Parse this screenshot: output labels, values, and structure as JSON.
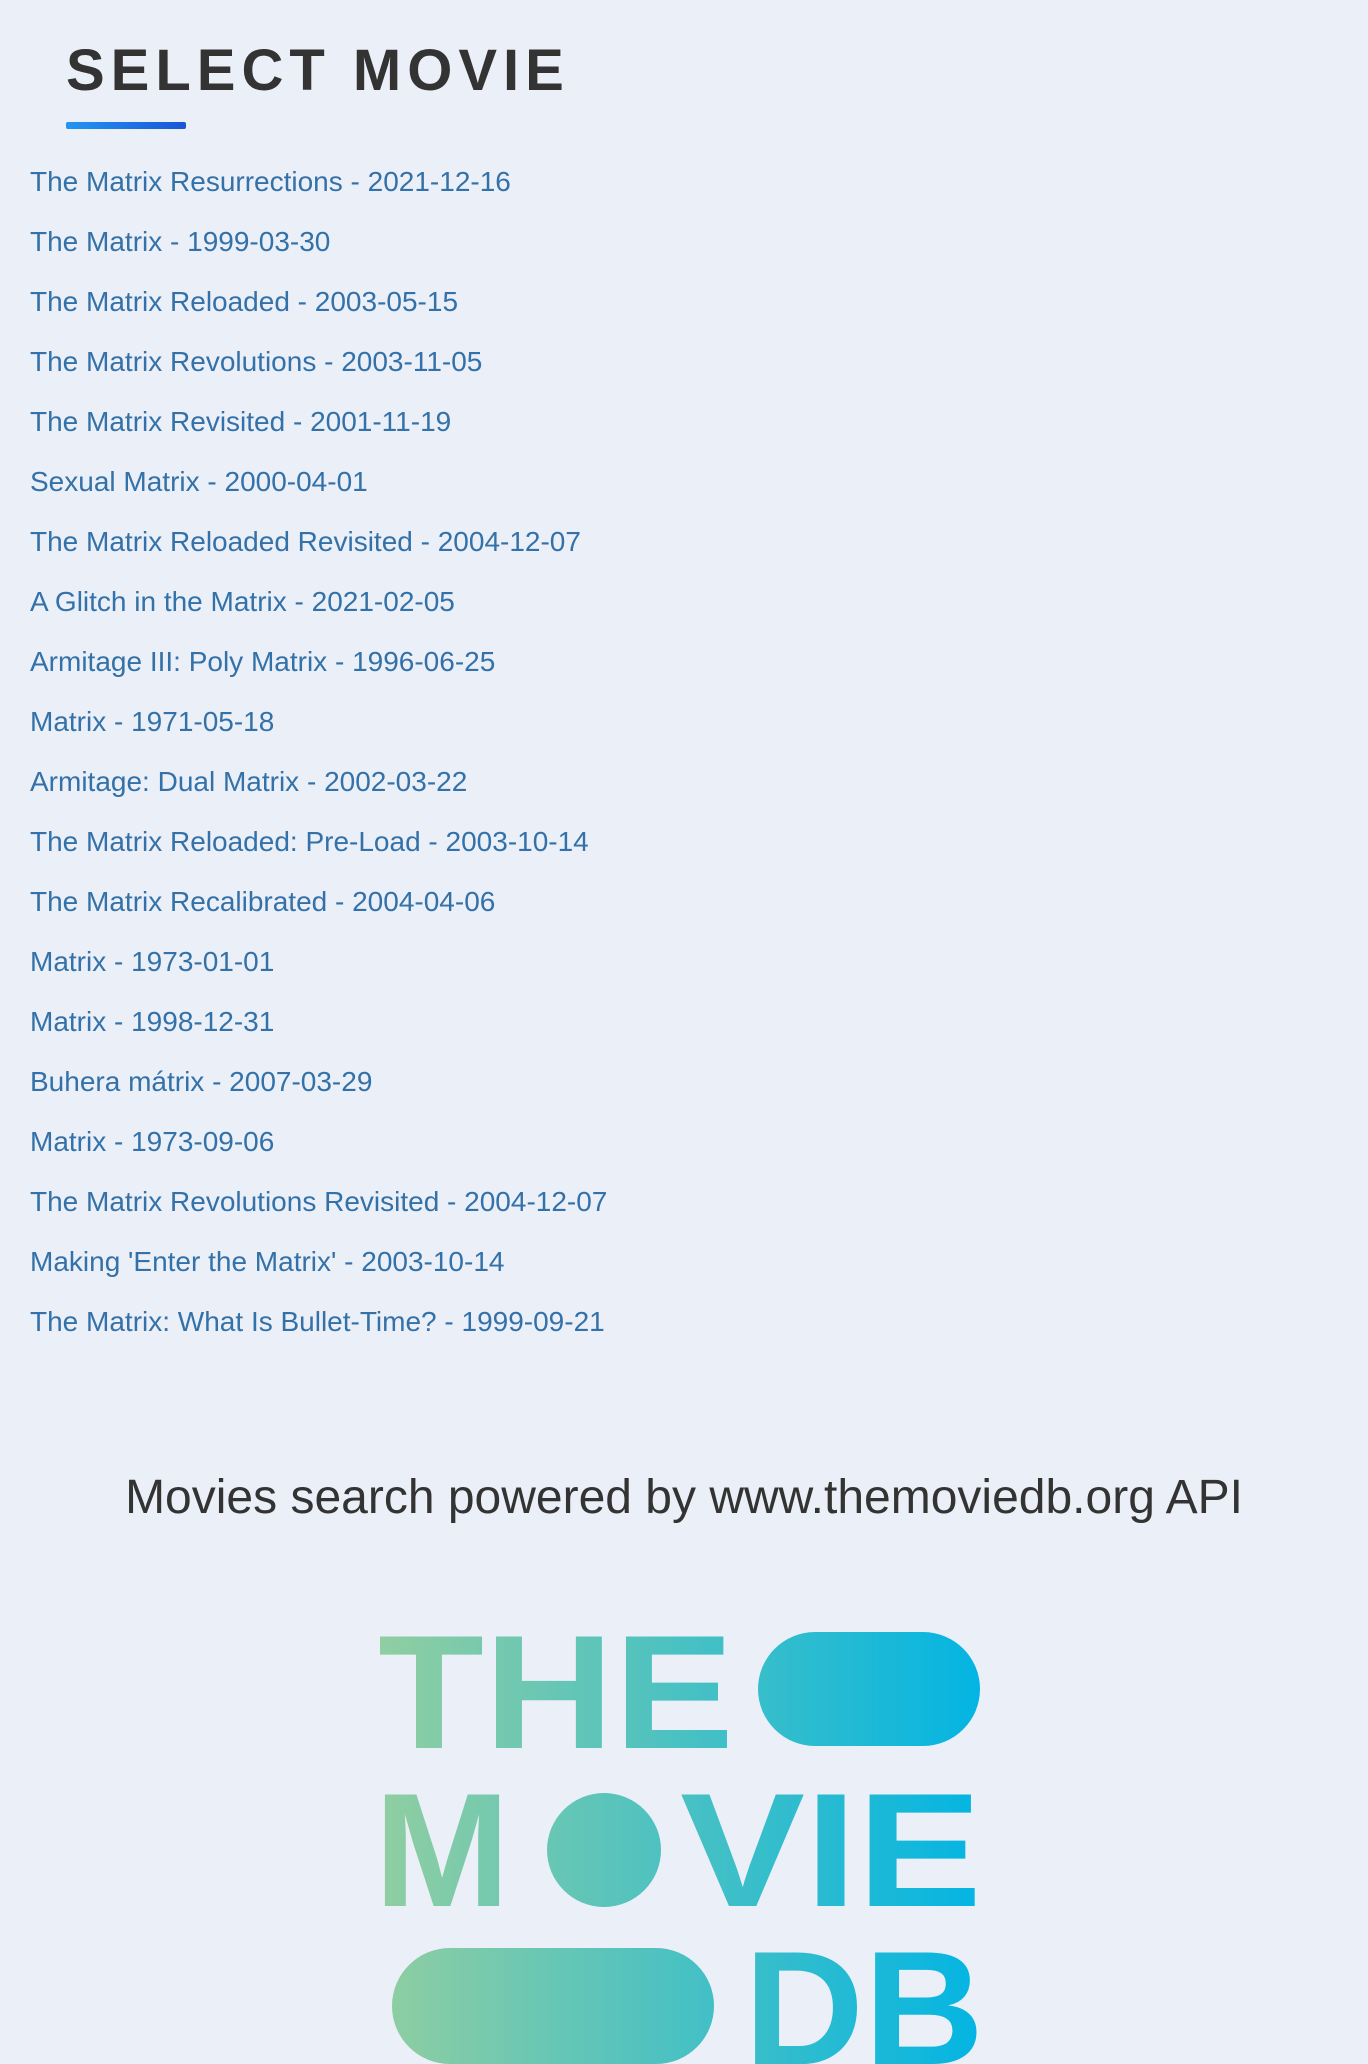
{
  "page": {
    "title": "SELECT MOVIE"
  },
  "movies": [
    {
      "label": "The Matrix Resurrections - 2021-12-16"
    },
    {
      "label": "The Matrix - 1999-03-30"
    },
    {
      "label": "The Matrix Reloaded - 2003-05-15"
    },
    {
      "label": "The Matrix Revolutions - 2003-11-05"
    },
    {
      "label": "The Matrix Revisited - 2001-11-19"
    },
    {
      "label": "Sexual Matrix - 2000-04-01"
    },
    {
      "label": "The Matrix Reloaded Revisited - 2004-12-07"
    },
    {
      "label": "A Glitch in the Matrix - 2021-02-05"
    },
    {
      "label": "Armitage III: Poly Matrix - 1996-06-25"
    },
    {
      "label": "Matrix - 1971-05-18"
    },
    {
      "label": "Armitage: Dual Matrix - 2002-03-22"
    },
    {
      "label": "The Matrix Reloaded: Pre-Load - 2003-10-14"
    },
    {
      "label": "The Matrix Recalibrated - 2004-04-06"
    },
    {
      "label": "Matrix - 1973-01-01"
    },
    {
      "label": "Matrix - 1998-12-31"
    },
    {
      "label": "Buhera mátrix - 2007-03-29"
    },
    {
      "label": "Matrix - 1973-09-06"
    },
    {
      "label": "The Matrix Revolutions Revisited - 2004-12-07"
    },
    {
      "label": "Making 'Enter the Matrix' - 2003-10-14"
    },
    {
      "label": "The Matrix: What Is Bullet-Time? - 1999-09-21"
    }
  ],
  "footer": {
    "powered_by": "Movies search powered by www.themoviedb.org API",
    "logo": {
      "name": "tmdb-logo",
      "line1": "THE",
      "line2_start": "M",
      "line2_end": "VIE",
      "line3": "DB",
      "gradient_start": "#90cea1",
      "gradient_end": "#01b4e4"
    }
  },
  "colors": {
    "background": "#ebeff8",
    "title": "#333333",
    "link": "#3371a8",
    "underline_start": "#2196f3",
    "underline_end": "#1a55d6"
  }
}
